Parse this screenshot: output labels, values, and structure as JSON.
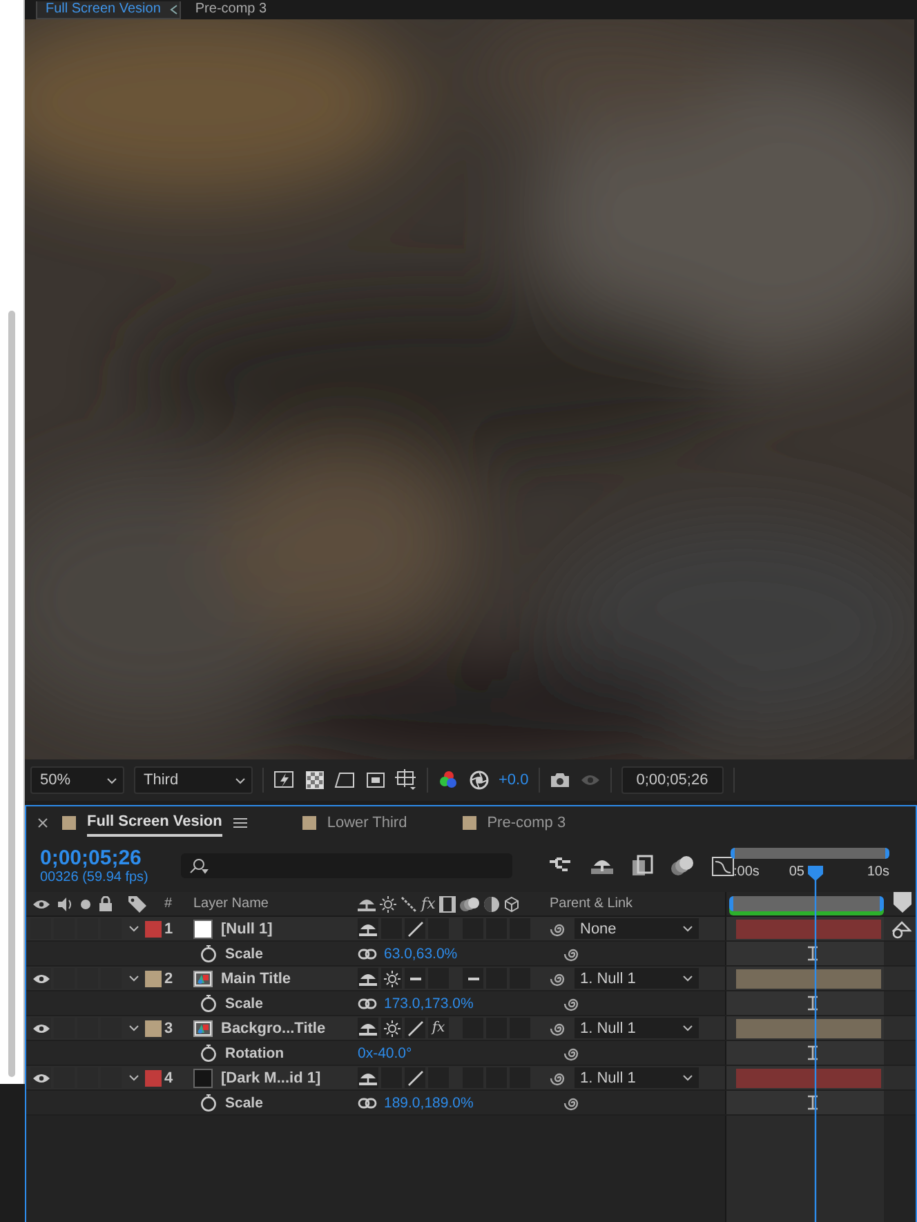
{
  "viewer_tabs": [
    {
      "label": "Full Screen Vesion",
      "selected": true
    },
    {
      "label": "Pre-comp 3",
      "selected": false
    }
  ],
  "viewer_toolbar": {
    "magnification": "50%",
    "resolution": "Third",
    "exposure": "+0.0",
    "timecode": "0;00;05;26"
  },
  "timeline": {
    "tabs": [
      {
        "label": "Full Screen Vesion",
        "color": "#b5a07f",
        "selected": true
      },
      {
        "label": "Lower Third",
        "color": "#b5a07f",
        "selected": false
      },
      {
        "label": "Pre-comp 3",
        "color": "#b5a07f",
        "selected": false
      }
    ],
    "current_time": "0;00;05;26",
    "frame_info": "00326 (59.94 fps)",
    "ruler_labels": [
      ":00s",
      "05",
      "10s"
    ],
    "columns": {
      "number": "#",
      "layer_name": "Layer Name",
      "effects": "fx",
      "parent": "Parent & Link"
    },
    "layers": [
      {
        "number": "1",
        "name": "[Null 1]",
        "kind": "null",
        "color": "#c03b3b",
        "visible": false,
        "collapse": false,
        "draft": false,
        "motion_blur": false,
        "parent": "None",
        "property": {
          "name": "Scale",
          "value": "63.0,63.0%",
          "linked": true
        }
      },
      {
        "number": "2",
        "name": "Main Title",
        "kind": "comp",
        "color": "#b5a07f",
        "visible": true,
        "collapse": true,
        "draft": true,
        "motion_blur": true,
        "parent": "1. Null 1",
        "property": {
          "name": "Scale",
          "value": "173.0,173.0%",
          "linked": true
        }
      },
      {
        "number": "3",
        "name": "Backgro...Title",
        "kind": "comp",
        "color": "#b5a07f",
        "visible": true,
        "collapse": true,
        "draft": false,
        "motion_blur": false,
        "fx_switch": "fx",
        "parent": "1. Null 1",
        "property": {
          "name": "Rotation",
          "value": "0x-40.0°",
          "linked": false
        }
      },
      {
        "number": "4",
        "name": "[Dark M...id 1]",
        "kind": "solid",
        "color": "#c03b3b",
        "visible": true,
        "collapse": false,
        "draft": false,
        "motion_blur": false,
        "parent": "1. Null 1",
        "property": {
          "name": "Scale",
          "value": "189.0,189.0%",
          "linked": true
        }
      }
    ]
  }
}
